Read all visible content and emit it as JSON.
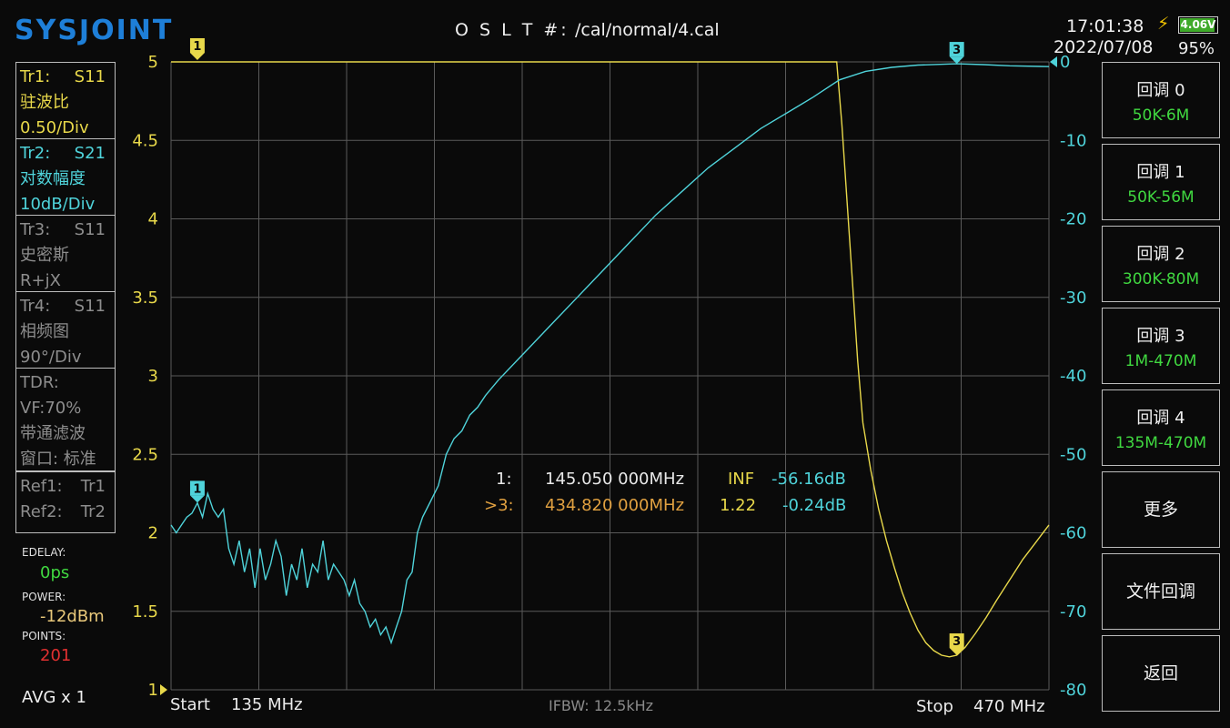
{
  "header": {
    "logo": "SYSJOINT",
    "cal_label": "O S L T #:",
    "cal_path": "/cal/normal/4.cal",
    "time": "17:01:38",
    "date": "2022/07/08",
    "battery_voltage": "4.06V",
    "battery_percent": "95%",
    "battery_level": 0.95,
    "charging_icon": "lightning-bolt-icon"
  },
  "traces": [
    {
      "id": "Tr1:",
      "param": "S11",
      "format": "驻波比",
      "scale": "0.50/Div",
      "color": "#e8d84a"
    },
    {
      "id": "Tr2:",
      "param": "S21",
      "format": "对数幅度",
      "scale": "10dB/Div",
      "color": "#4fd3da"
    },
    {
      "id": "Tr3:",
      "param": "S11",
      "format": "史密斯",
      "scale": "R+jX",
      "color": "#8d8d8d"
    },
    {
      "id": "Tr4:",
      "param": "S11",
      "format": "相频图",
      "scale": "90°/Div",
      "color": "#8d8d8d"
    }
  ],
  "tdr": {
    "title": "TDR:",
    "vf": "VF:70%",
    "mode": "带通滤波",
    "window": "窗口: 标准"
  },
  "refs": {
    "ref1": "Ref1:",
    "ref1_val": "Tr1",
    "ref2": "Ref2:",
    "ref2_val": "Tr2"
  },
  "stats": {
    "edelay_label": "EDELAY:",
    "edelay_value": "0ps",
    "power_label": "POWER:",
    "power_value": "-12dBm",
    "points_label": "POINTS:",
    "points_value": "201",
    "avg": "AVG x 1"
  },
  "menu": [
    {
      "label": "回调 0",
      "value": "50K-6M"
    },
    {
      "label": "回调 1",
      "value": "50K-56M"
    },
    {
      "label": "回调 2",
      "value": "300K-80M"
    },
    {
      "label": "回调 3",
      "value": "1M-470M"
    },
    {
      "label": "回调 4",
      "value": "135M-470M"
    },
    {
      "label": "更多",
      "value": ""
    },
    {
      "label": "文件回调",
      "value": ""
    },
    {
      "label": "返回",
      "value": ""
    }
  ],
  "footer": {
    "start_label": "Start",
    "start_value": "135 MHz",
    "ifbw": "IFBW: 12.5kHz",
    "stop_label": "Stop",
    "stop_value": "470 MHz"
  },
  "marker_readout": [
    {
      "id": "1:",
      "freq": "145.050 000MHz",
      "swr": "INF",
      "db": "-56.16dB",
      "color": "#e8e8e8"
    },
    {
      "id": ">3:",
      "freq": "434.820 000MHz",
      "swr": "1.22",
      "db": "-0.24dB",
      "color": "#e0a040"
    }
  ],
  "chart_data": {
    "type": "line",
    "x_start_mhz": 135,
    "x_end_mhz": 470,
    "left_axis": {
      "ticks": [
        "5",
        "4.5",
        "4",
        "3.5",
        "3",
        "2.5",
        "2",
        "1.5",
        "1"
      ],
      "min": 1,
      "max": 5,
      "color": "#e8d84a"
    },
    "right_axis": {
      "ticks": [
        "0",
        "-10",
        "-20",
        "-30",
        "-40",
        "-50",
        "-60",
        "-70",
        "-80"
      ],
      "min": -80,
      "max": 0,
      "color": "#4fd3da"
    },
    "grid": true,
    "series": [
      {
        "name": "Tr1 S11 SWR",
        "color": "#e8d84a",
        "axis": "left",
        "points": [
          [
            135,
            5
          ],
          [
            388,
            5
          ],
          [
            389,
            5
          ],
          [
            391,
            4.6
          ],
          [
            393,
            4.1
          ],
          [
            395,
            3.6
          ],
          [
            397,
            3.1
          ],
          [
            399,
            2.7
          ],
          [
            402,
            2.4
          ],
          [
            405,
            2.15
          ],
          [
            408,
            1.95
          ],
          [
            411,
            1.78
          ],
          [
            414,
            1.62
          ],
          [
            417,
            1.49
          ],
          [
            420,
            1.38
          ],
          [
            423,
            1.3
          ],
          [
            426,
            1.25
          ],
          [
            429,
            1.22
          ],
          [
            432,
            1.21
          ],
          [
            434.82,
            1.22
          ],
          [
            438,
            1.27
          ],
          [
            442,
            1.36
          ],
          [
            446,
            1.46
          ],
          [
            450,
            1.57
          ],
          [
            455,
            1.7
          ],
          [
            460,
            1.83
          ],
          [
            465,
            1.94
          ],
          [
            470,
            2.05
          ]
        ]
      },
      {
        "name": "Tr2 S21 LogMag",
        "color": "#4fd3da",
        "axis": "right",
        "points": [
          [
            135,
            -59
          ],
          [
            137,
            -60
          ],
          [
            139,
            -59
          ],
          [
            141,
            -58
          ],
          [
            143,
            -57.5
          ],
          [
            145.05,
            -56.2
          ],
          [
            147,
            -58
          ],
          [
            149,
            -55
          ],
          [
            151,
            -57
          ],
          [
            153,
            -58
          ],
          [
            155,
            -57
          ],
          [
            157,
            -62
          ],
          [
            159,
            -64
          ],
          [
            161,
            -61
          ],
          [
            163,
            -65
          ],
          [
            165,
            -62
          ],
          [
            167,
            -67
          ],
          [
            169,
            -62
          ],
          [
            171,
            -66
          ],
          [
            173,
            -64
          ],
          [
            175,
            -61
          ],
          [
            177,
            -63
          ],
          [
            179,
            -68
          ],
          [
            181,
            -64
          ],
          [
            183,
            -66
          ],
          [
            185,
            -62
          ],
          [
            187,
            -67
          ],
          [
            189,
            -64
          ],
          [
            191,
            -65
          ],
          [
            193,
            -61
          ],
          [
            195,
            -66
          ],
          [
            197,
            -64
          ],
          [
            199,
            -65
          ],
          [
            201,
            -66
          ],
          [
            203,
            -68
          ],
          [
            205,
            -66
          ],
          [
            207,
            -69
          ],
          [
            209,
            -70
          ],
          [
            211,
            -72
          ],
          [
            213,
            -71
          ],
          [
            215,
            -73
          ],
          [
            217,
            -72
          ],
          [
            219,
            -74
          ],
          [
            221,
            -72
          ],
          [
            223,
            -70
          ],
          [
            225,
            -66
          ],
          [
            227,
            -65
          ],
          [
            229,
            -60
          ],
          [
            231,
            -58
          ],
          [
            234,
            -56
          ],
          [
            237,
            -54
          ],
          [
            240,
            -50
          ],
          [
            243,
            -48
          ],
          [
            246,
            -47
          ],
          [
            249,
            -45
          ],
          [
            252,
            -44
          ],
          [
            255,
            -42.5
          ],
          [
            260,
            -40.5
          ],
          [
            270,
            -37
          ],
          [
            280,
            -33.5
          ],
          [
            290,
            -30
          ],
          [
            300,
            -26.5
          ],
          [
            310,
            -23
          ],
          [
            320,
            -19.5
          ],
          [
            330,
            -16.5
          ],
          [
            340,
            -13.5
          ],
          [
            350,
            -11
          ],
          [
            360,
            -8.5
          ],
          [
            370,
            -6.5
          ],
          [
            380,
            -4.5
          ],
          [
            390,
            -2.3
          ],
          [
            400,
            -1.2
          ],
          [
            410,
            -0.7
          ],
          [
            420,
            -0.4
          ],
          [
            434.82,
            -0.24
          ],
          [
            445,
            -0.35
          ],
          [
            455,
            -0.5
          ],
          [
            470,
            -0.6
          ]
        ]
      }
    ],
    "markers": [
      {
        "label": "1",
        "trace": "Tr1",
        "x": 145.05,
        "y": 5,
        "color": "#e8d84a"
      },
      {
        "label": "1",
        "trace": "Tr2",
        "x": 145.05,
        "y": -56.16,
        "color": "#4fd3da"
      },
      {
        "label": "3",
        "trace": "Tr1",
        "x": 434.82,
        "y": 1.22,
        "color": "#e8d84a"
      },
      {
        "label": "3",
        "trace": "Tr2",
        "x": 434.82,
        "y": -0.24,
        "color": "#4fd3da"
      }
    ]
  }
}
